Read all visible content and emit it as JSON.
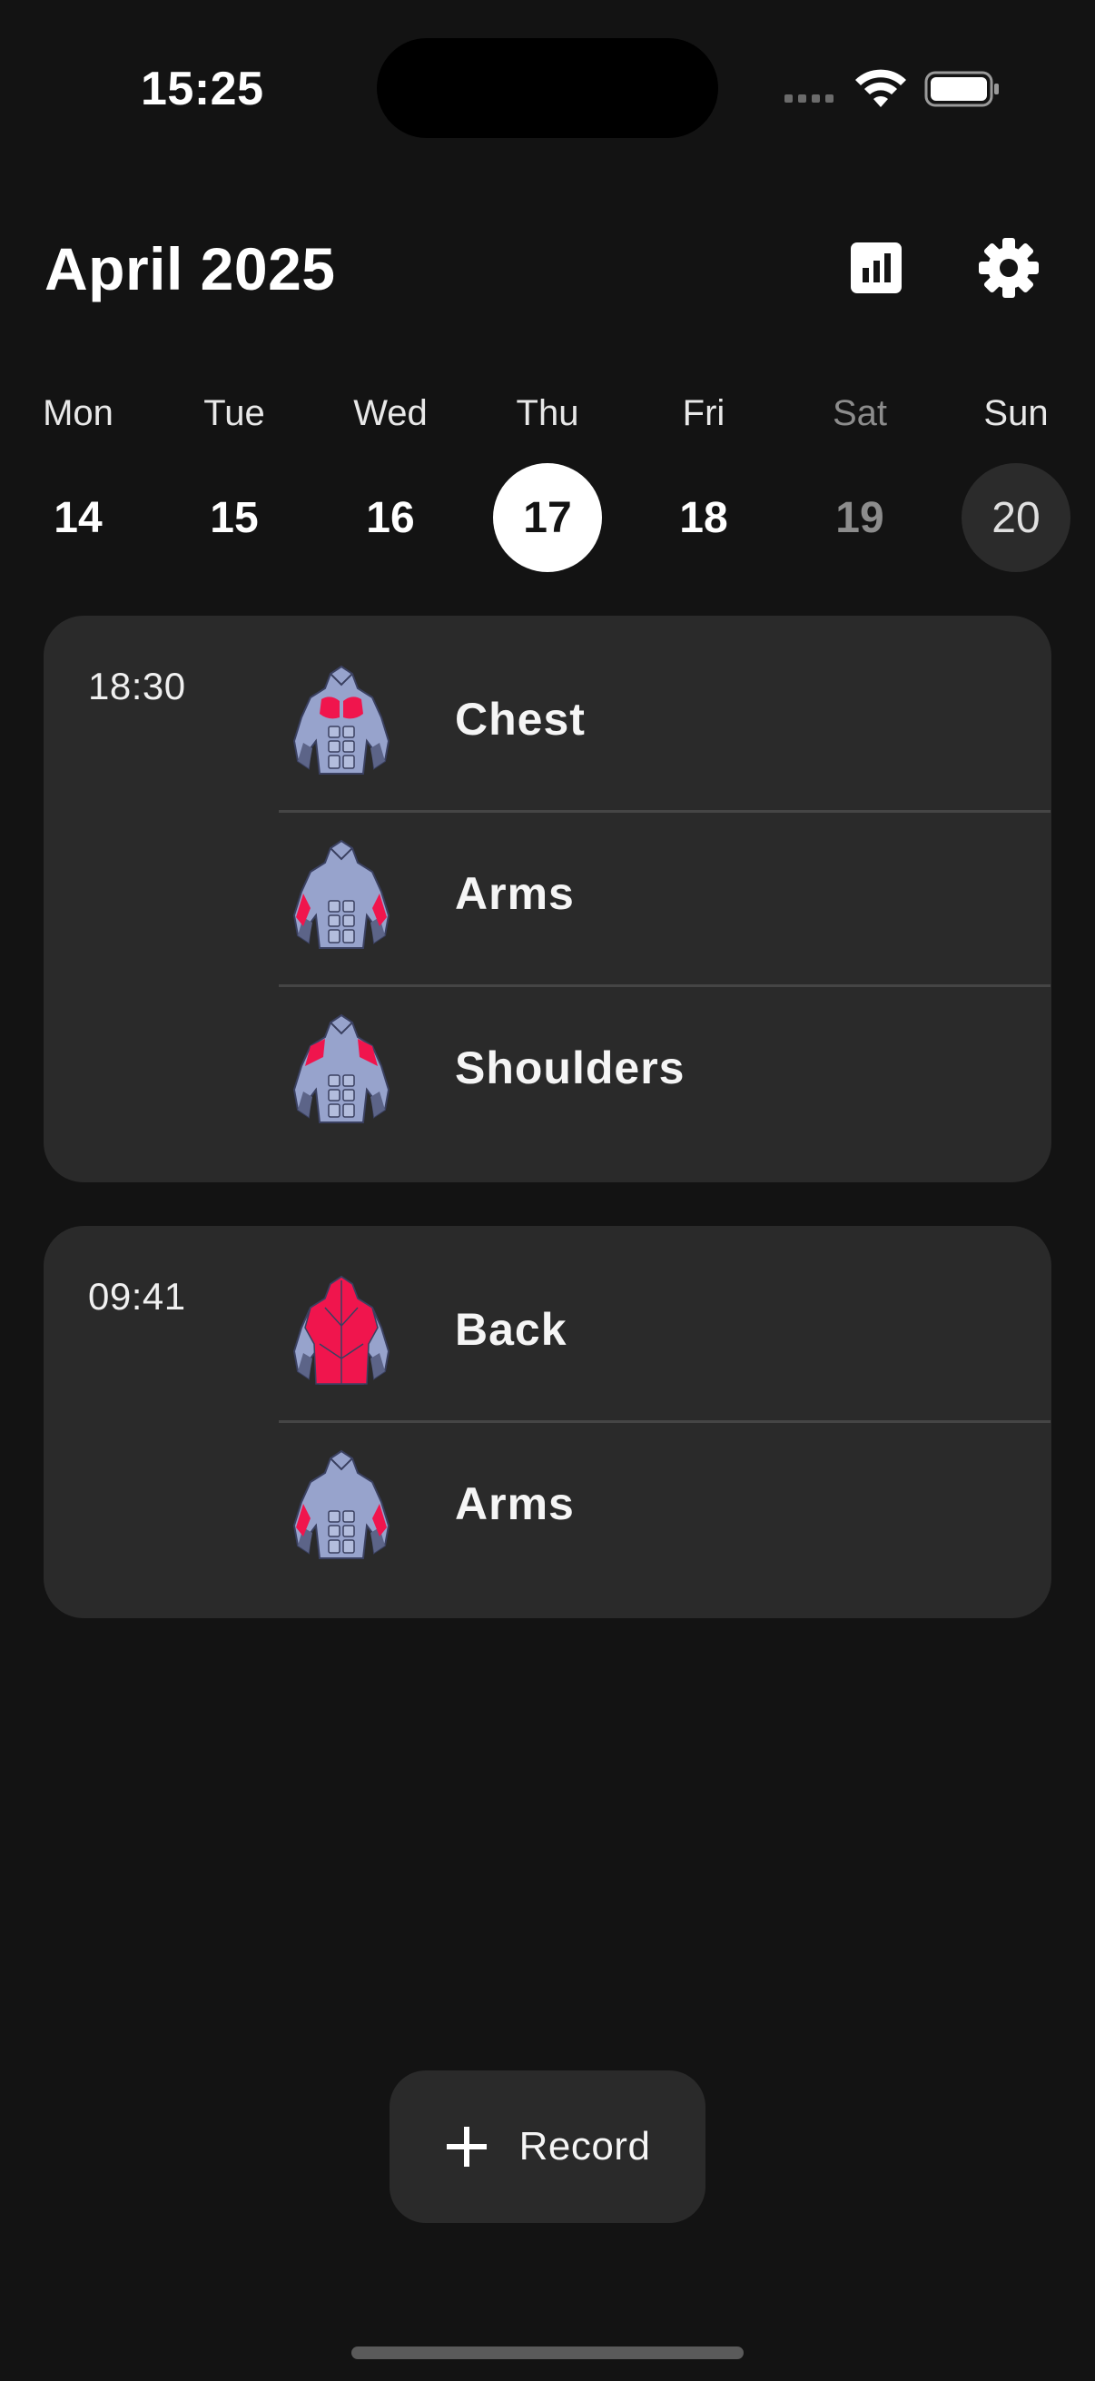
{
  "status_bar": {
    "time": "15:25"
  },
  "header": {
    "title": "April 2025"
  },
  "week": [
    {
      "name": "Mon",
      "num": "14"
    },
    {
      "name": "Tue",
      "num": "15"
    },
    {
      "name": "Wed",
      "num": "16"
    },
    {
      "name": "Thu",
      "num": "17"
    },
    {
      "name": "Fri",
      "num": "18"
    },
    {
      "name": "Sat",
      "num": "19"
    },
    {
      "name": "Sun",
      "num": "20"
    }
  ],
  "workouts": [
    {
      "time": "18:30",
      "items": [
        {
          "label": "Chest",
          "icon": "chest-muscle-icon"
        },
        {
          "label": "Arms",
          "icon": "arms-muscle-icon"
        },
        {
          "label": "Shoulders",
          "icon": "shoulders-muscle-icon"
        }
      ]
    },
    {
      "time": "09:41",
      "items": [
        {
          "label": "Back",
          "icon": "back-muscle-icon"
        },
        {
          "label": "Arms",
          "icon": "arms-muscle-icon"
        }
      ]
    }
  ],
  "record_button": {
    "label": "Record"
  },
  "colors": {
    "background": "#131313",
    "card": "#2a2a2a",
    "highlight": "#f0154d",
    "body": "#97a3cc"
  }
}
